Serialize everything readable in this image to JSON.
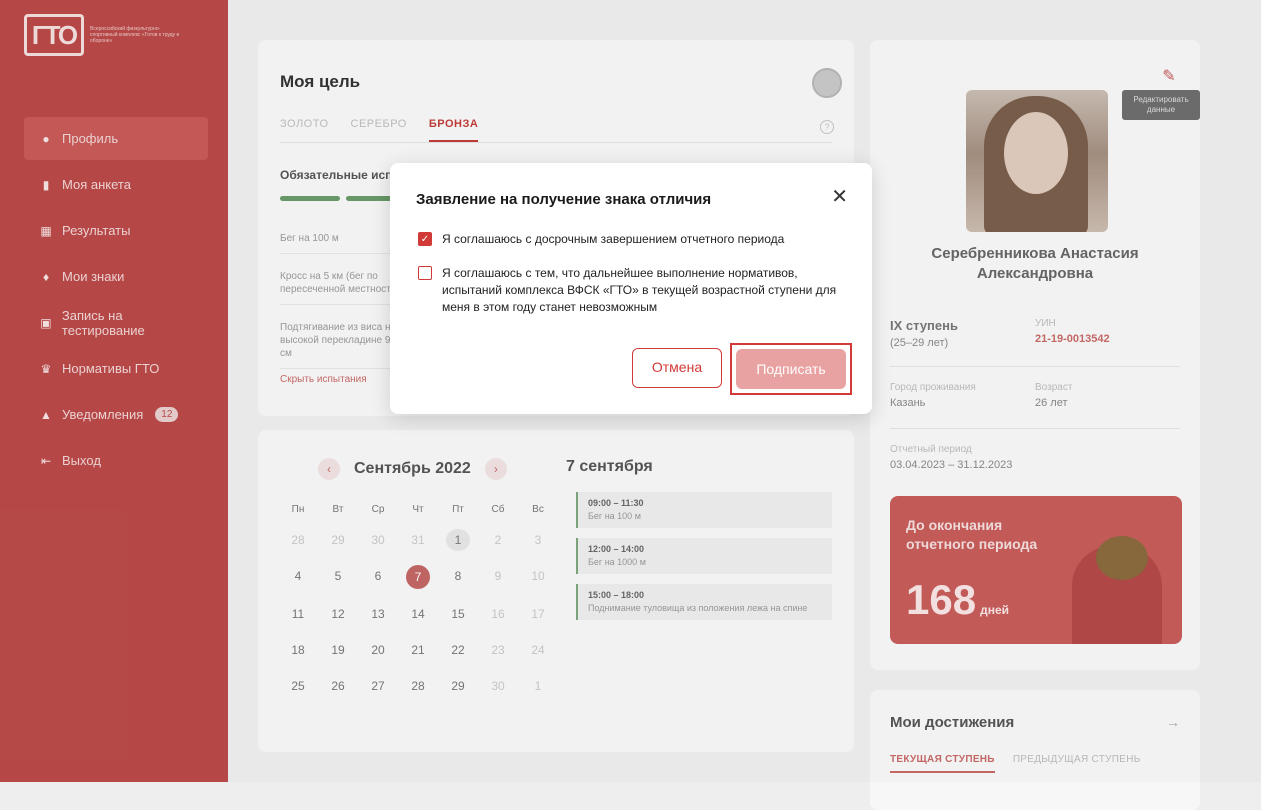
{
  "brand": {
    "logo_text": "ГТО",
    "tagline": "Всероссийский физкультурно-спортивный комплекс «Готов к труду и обороне»"
  },
  "sidebar": {
    "items": [
      {
        "label": "Профиль",
        "icon": "user-icon"
      },
      {
        "label": "Моя анкета",
        "icon": "document-icon"
      },
      {
        "label": "Результаты",
        "icon": "table-icon"
      },
      {
        "label": "Мои знаки",
        "icon": "medal-icon"
      },
      {
        "label": "Запись на тестирование",
        "icon": "calendar-icon"
      },
      {
        "label": "Нормативы ГТО",
        "icon": "trophy-icon"
      },
      {
        "label": "Уведомления",
        "icon": "bell-icon",
        "badge": "12"
      },
      {
        "label": "Выход",
        "icon": "logout-icon"
      }
    ]
  },
  "goal": {
    "title": "Моя цель",
    "tabs": [
      "ЗОЛОТО",
      "СЕРЕБРО",
      "БРОНЗА"
    ],
    "active_tab": "БРОНЗА",
    "required_title": "Обязательные испытания",
    "tests": [
      "Бег на 100 м",
      "Кросс на 5 км (бег по пересеченной местности)",
      "Подтягивание из виса на высокой перекладине 90 см"
    ],
    "hide_link": "Скрыть испытания"
  },
  "calendar": {
    "month": "Сентябрь 2022",
    "weekdays": [
      "Пн",
      "Вт",
      "Ср",
      "Чт",
      "Пт",
      "Сб",
      "Вс"
    ],
    "day_title": "7 сентября",
    "events": [
      {
        "time": "09:00 – 11:30",
        "name": "Бег на 100 м"
      },
      {
        "time": "12:00 – 14:00",
        "name": "Бег на 1000 м"
      },
      {
        "time": "15:00 – 18:00",
        "name": "Поднимание туловища из положения лежа на спине"
      }
    ]
  },
  "profile": {
    "edit_tooltip": "Редактировать данные",
    "full_name": "Серебренникова Анастасия Александровна",
    "level": "IX ступень",
    "age_range": "(25–29 лет)",
    "uin_label": "УИН",
    "uin": "21-19-0013542",
    "city_label": "Город проживания",
    "city": "Казань",
    "age_label": "Возраст",
    "age": "26 лет",
    "period_label": "Отчетный период",
    "period": "03.04.2023 – 31.12.2023",
    "countdown_title": "До окончания отчетного периода",
    "countdown_value": "168",
    "countdown_unit": "дней"
  },
  "achievements": {
    "title": "Мои достижения",
    "tabs": [
      "ТЕКУЩАЯ СТУПЕНЬ",
      "ПРЕДЫДУЩАЯ СТУПЕНЬ"
    ]
  },
  "modal": {
    "title": "Заявление на получение знака отличия",
    "checkbox1": "Я соглашаюсь с досрочным завершением отчетного периода",
    "checkbox1_checked": true,
    "checkbox2": "Я соглашаюсь с тем, что дальнейшее выполнение нормативов, испытаний комплекса ВФСК «ГТО» в текущей возрастной ступени для меня в этом году станет невозможным",
    "checkbox2_checked": false,
    "cancel": "Отмена",
    "sign": "Подписать"
  },
  "colors": {
    "sidebar": "#b94a48",
    "accent": "#d23a37",
    "sign_disabled": "#e8a2a1"
  }
}
